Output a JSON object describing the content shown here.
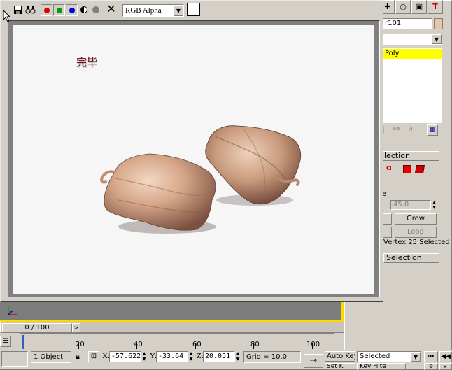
{
  "render_window": {
    "channel_select": "RGB Alpha",
    "overlay_text": "完毕"
  },
  "command_panel": {
    "name_field": "r101",
    "modifier_item": "Poly",
    "rollout_selection_label": "lection",
    "threshold_label": "e",
    "threshold_value": "45.0",
    "grow_label": "Grow",
    "loop_label": "Loop",
    "status_text": "Vertex 25 Selected",
    "soft_selection_label": "Selection",
    "swatch_color": "#e8c4a8",
    "highlight_color": "#ffff00"
  },
  "timeline": {
    "frame_counter": "0 / 100",
    "ruler_labels": [
      "20",
      "40",
      "60",
      "80",
      "100"
    ]
  },
  "status_bar": {
    "selection_count": "1 Object",
    "x_label": "X:",
    "x_value": "-57.622",
    "y_label": "Y:",
    "y_value": "-33.64",
    "z_label": "Z:",
    "z_value": "20.051",
    "grid_text": "Grid = 10.0",
    "auto_key_label": "Auto Key",
    "set_key_label": "Set K",
    "key_mode_select": "Selected",
    "key_filters_label": "Key Filte"
  }
}
